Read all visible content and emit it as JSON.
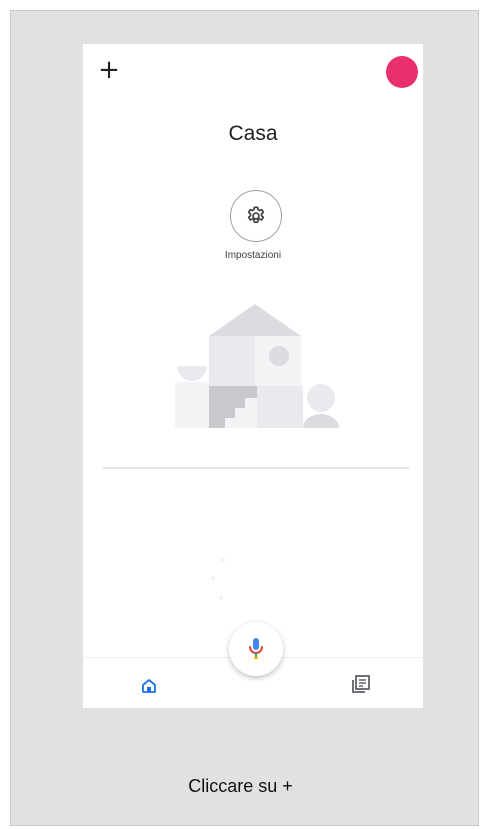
{
  "app": {
    "add_label": "+",
    "home_title": "Casa",
    "settings_label": "Impostazioni"
  },
  "icons": {
    "add": "plus-icon",
    "settings": "gear-icon",
    "mic": "microphone-icon",
    "home": "home-icon",
    "feed": "feed-icon"
  },
  "colors": {
    "avatar": "#ea2f6f",
    "active_nav": "#1a73e8"
  },
  "caption": "Cliccare su +"
}
